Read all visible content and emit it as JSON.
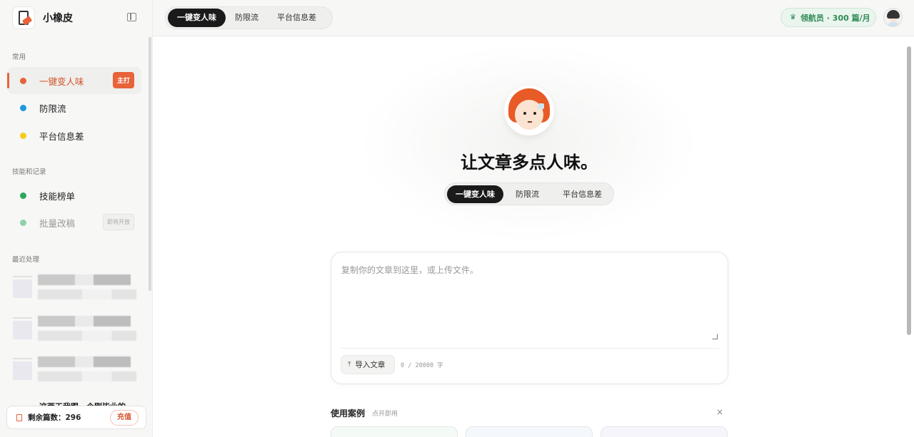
{
  "app": {
    "name": "小橡皮"
  },
  "sidebar": {
    "section_common": "常用",
    "items": [
      {
        "label": "一键变人味",
        "dot": "#e8623a",
        "tag": "主打"
      },
      {
        "label": "防限流",
        "dot": "#1b9ae0"
      },
      {
        "label": "平台信息差",
        "dot": "#f5cd1a"
      }
    ],
    "section_skills": "技能和记录",
    "skills": [
      {
        "label": "技能榜单",
        "dot": "#2aa85c"
      },
      {
        "label": "批量改稿",
        "dot": "#8ed2a6",
        "tag": "即将开放"
      }
    ],
    "section_recent": "最近处理",
    "recent_partial_text": "这两天我跟一个刚毕业的...",
    "quota_label": "剩余篇数：296",
    "recharge_label": "充值"
  },
  "topbar": {
    "tabs": [
      "一键变人味",
      "防限流",
      "平台信息差"
    ],
    "active_tab": "一键变人味",
    "membership": "领航员 · 300 篇/月"
  },
  "hero": {
    "title": "让文章多点人味。",
    "tabs": [
      "一键变人味",
      "防限流",
      "平台信息差"
    ]
  },
  "editor": {
    "placeholder": "复制你的文章到这里，或上传文件。",
    "import_label": "导入文章",
    "counter": "0 / 20000 字"
  },
  "cases": {
    "title": "使用案例",
    "hint": "点开即用",
    "close": "×"
  },
  "colors": {
    "accent": "#e8623a",
    "member_green": "#2f8a55"
  }
}
